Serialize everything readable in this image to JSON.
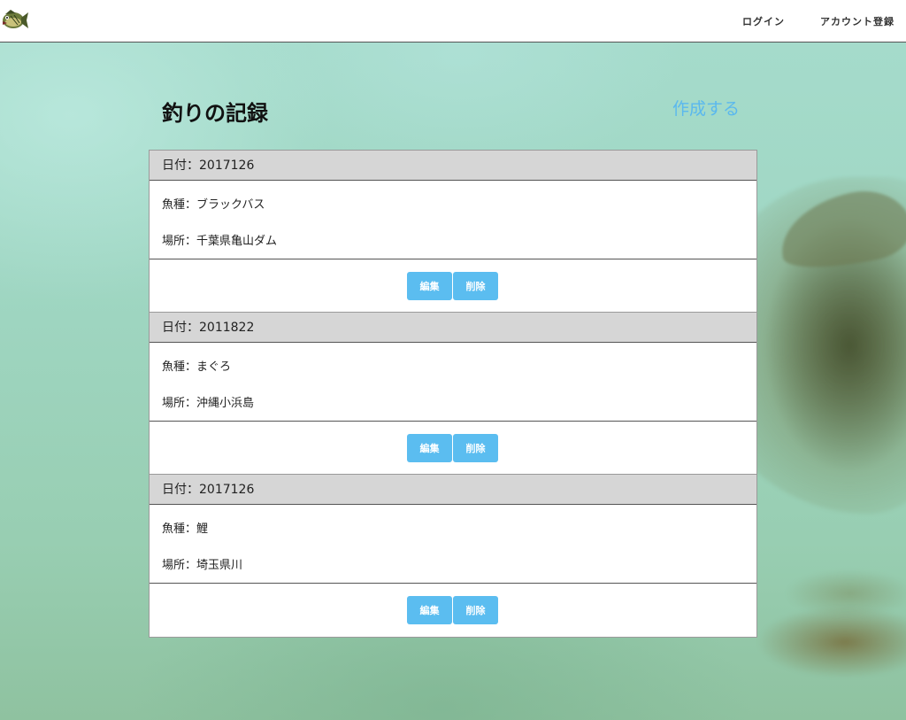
{
  "header": {
    "logo_icon": "bass-fish-logo-icon",
    "nav": {
      "login_label": "ログイン",
      "signup_label": "アカウント登録"
    }
  },
  "main": {
    "title": "釣りの記録",
    "create_label": "作成する",
    "records": [
      {
        "date": "日付：2017126",
        "fish": "魚種：ブラックバス",
        "place": "場所：千葉県亀山ダム",
        "edit_label": "編集",
        "delete_label": "削除"
      },
      {
        "date": "日付：2011822",
        "fish": "魚種：まぐろ",
        "place": "場所：沖縄小浜島",
        "edit_label": "編集",
        "delete_label": "削除"
      },
      {
        "date": "日付：2017126",
        "fish": "魚種：鯉",
        "place": "場所：埼玉県川",
        "edit_label": "編集",
        "delete_label": "削除"
      }
    ]
  },
  "colors": {
    "accent": "#5bbdf0",
    "header_bg": "#ffffff",
    "row_head_bg": "#d6d6d6"
  }
}
